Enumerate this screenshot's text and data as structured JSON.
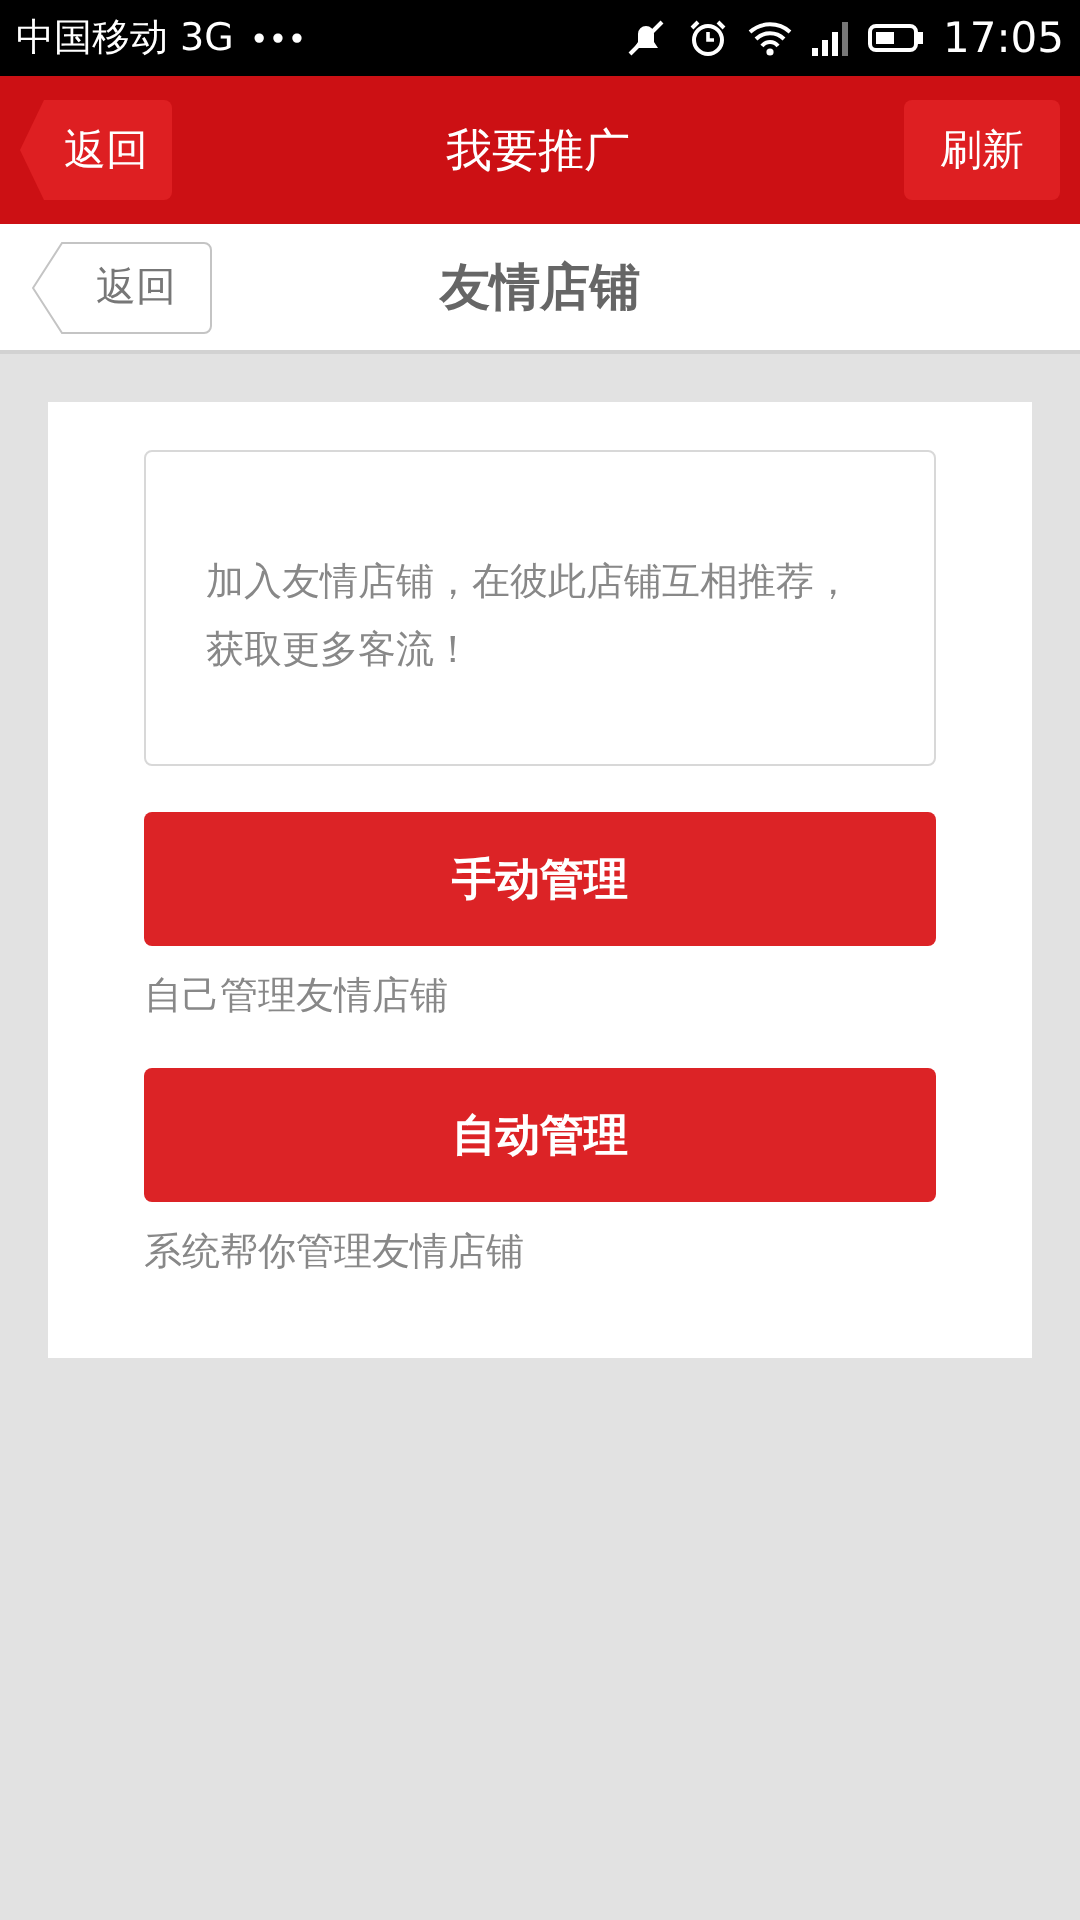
{
  "status_bar": {
    "carrier": "中国移动 3G",
    "more": "•••",
    "time": "17:05"
  },
  "header": {
    "back": "返回",
    "title": "我要推广",
    "refresh": "刷新"
  },
  "subheader": {
    "back": "返回",
    "title": "友情店铺"
  },
  "intro": "加入友情店铺，在彼此店铺互相推荐，获取更多客流！",
  "options": [
    {
      "button": "手动管理",
      "caption": "自己管理友情店铺"
    },
    {
      "button": "自动管理",
      "caption": "系统帮你管理友情店铺"
    }
  ]
}
